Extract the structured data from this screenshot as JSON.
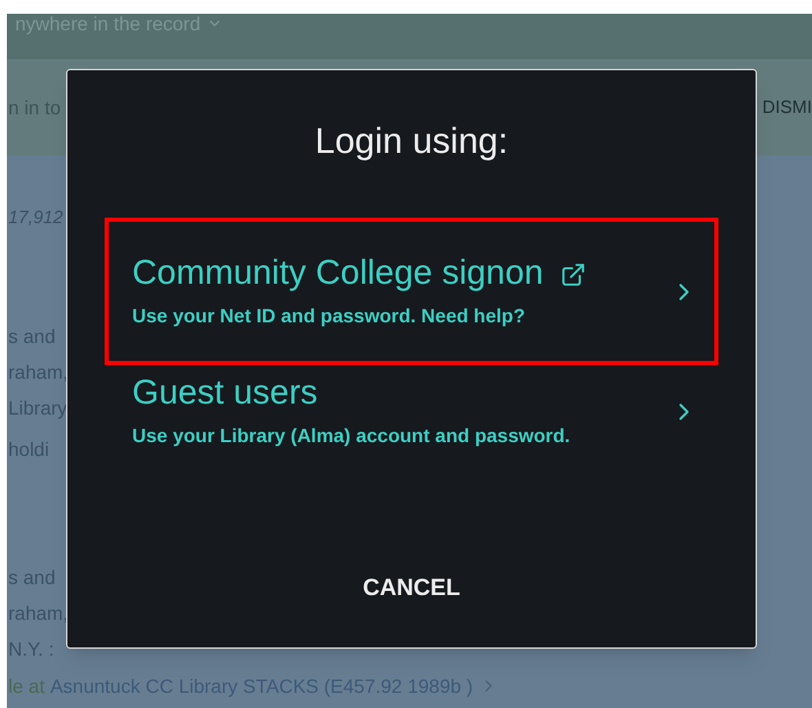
{
  "background": {
    "search_scope": "nywhere in the record",
    "banner": {
      "text": "n in to",
      "dismiss": "DISMI"
    },
    "result_count": "17,912",
    "records": [
      {
        "lines": [
          "s and",
          "raham,",
          "Library"
        ],
        "holdings": "holdi"
      },
      {
        "lines": [
          "s and",
          "raham,",
          "N.Y. :"
        ]
      }
    ],
    "availability": {
      "status": "le at",
      "location": "Asnuntuck CC Library  STACKS (E457.92 1989b )"
    }
  },
  "dialog": {
    "title": "Login using:",
    "options": [
      {
        "title": "Community College signon",
        "subtitle": "Use your Net ID and password. Need help?",
        "external": true,
        "highlighted": true
      },
      {
        "title": "Guest users",
        "subtitle": "Use your Library (Alma) account and password.",
        "external": false,
        "highlighted": false
      }
    ],
    "cancel": "CANCEL"
  }
}
